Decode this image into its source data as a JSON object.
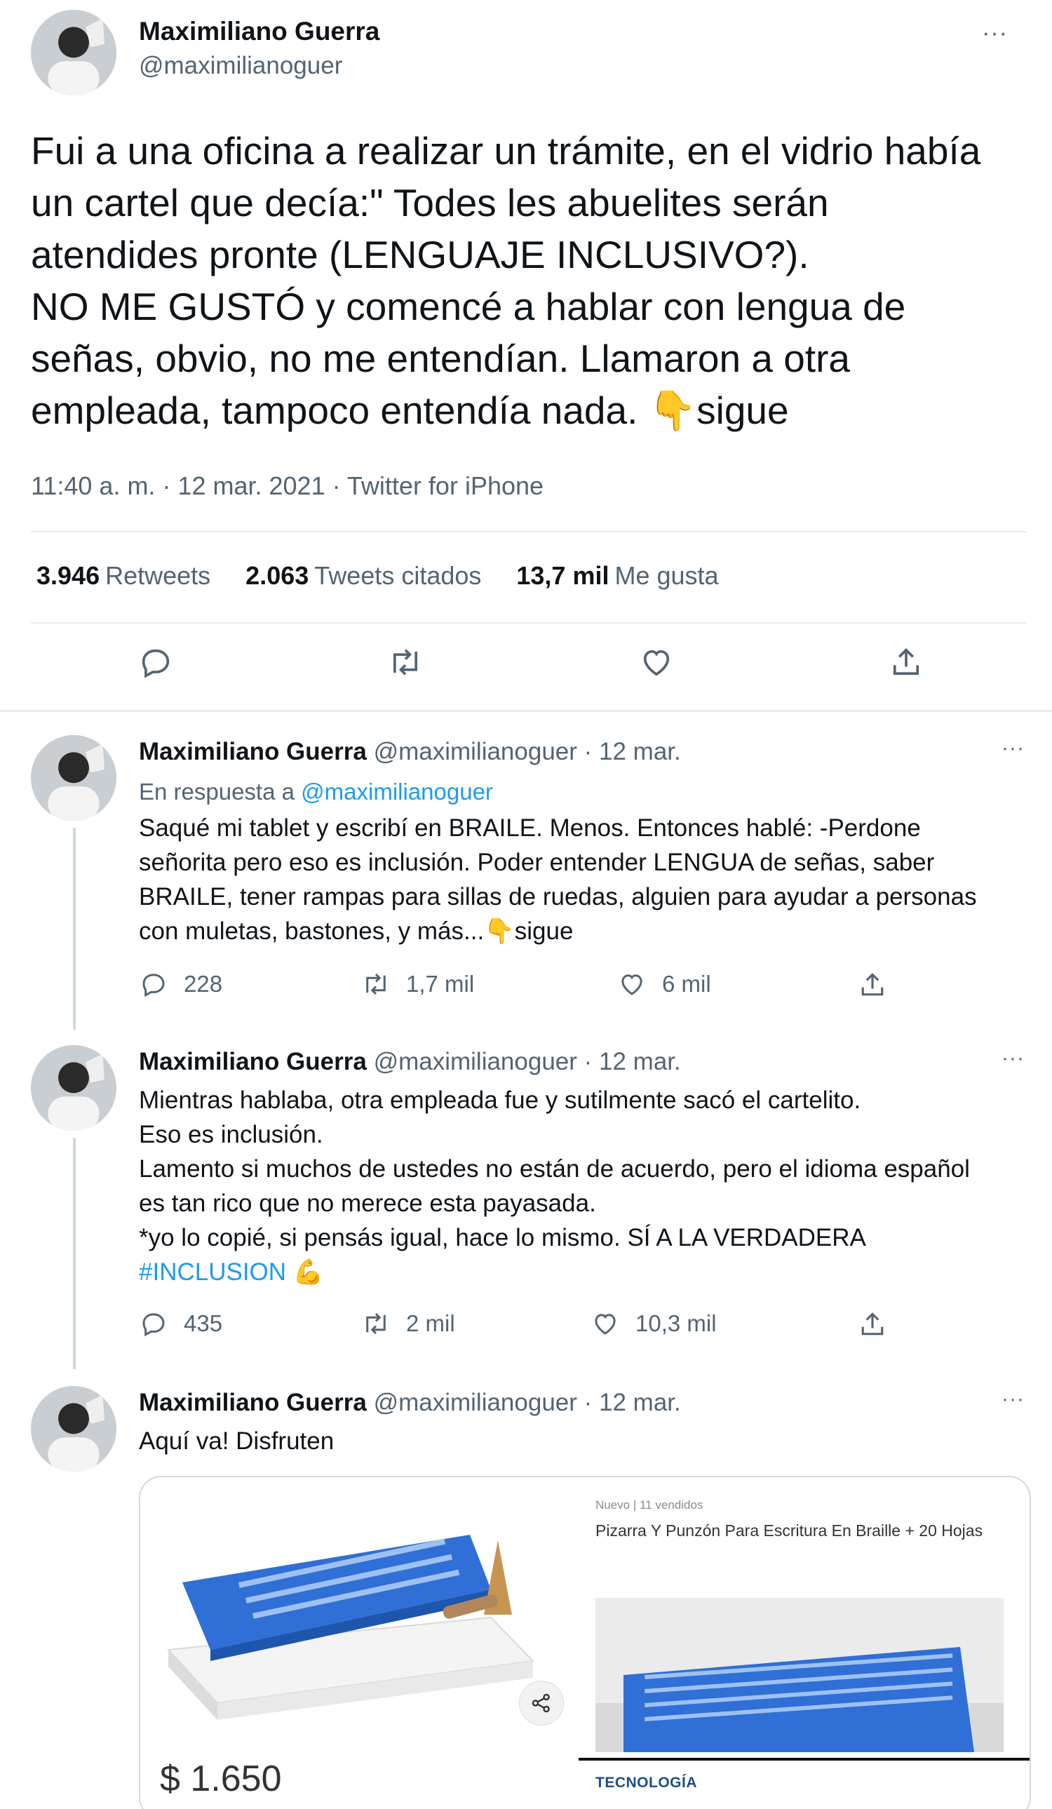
{
  "main_tweet": {
    "name": "Maximiliano Guerra",
    "handle": "@maximilianoguer",
    "more": "···",
    "text": "Fui a una oficina a realizar un trámite, en el vidrio había\nun cartel que decía:\" Todes les abuelites serán\natendides pronte (LENGUAJE INCLUSIVO?).\nNO ME GUSTÓ y comencé a hablar con lengua de\nseñas, obvio, no me entendían. Llamaron a otra\nempleada, tampoco entendía nada. 👇sigue",
    "meta": "11:40 a. m. · 12 mar. 2021 · Twitter for iPhone",
    "retweets_count": "3.946",
    "retweets_label": "Retweets",
    "quotes_count": "2.063",
    "quotes_label": "Tweets citados",
    "likes_count": "13,7 mil",
    "likes_label": "Me gusta"
  },
  "replies": [
    {
      "name": "Maximiliano Guerra",
      "handle_time": "@maximilianoguer · 12 mar.",
      "more": "···",
      "replying_prefix": "En respuesta a",
      "replying_to": "@maximilianoguer",
      "text": "Saqué mi tablet y escribí en BRAILE. Menos. Entonces hablé: -Perdone\nseñorita pero eso es inclusión. Poder entender LENGUA de señas, saber\nBRAILE, tener rampas para sillas de ruedas, alguien para ayudar a personas\ncon muletas, bastones, y más...👇sigue",
      "replies": "228",
      "retweets": "1,7 mil",
      "likes": "6 mil"
    },
    {
      "name": "Maximiliano Guerra",
      "handle_time": "@maximilianoguer · 12 mar.",
      "more": "···",
      "text": "Mientras hablaba, otra empleada fue y sutilmente sacó el cartelito.\nEso es inclusión.\nLamento si muchos de ustedes no están de acuerdo, pero el idioma español\nes tan rico que no merece esta payasada.\n*yo lo copié, si pensás igual, hace lo mismo. SÍ A LA VERDADERA",
      "hashtag": "#INCLUSION",
      "emoji": "💪",
      "replies": "435",
      "retweets": "2 mil",
      "likes": "10,3 mil"
    },
    {
      "name": "Maximiliano Guerra",
      "handle_time": "@maximilianoguer · 12 mar.",
      "more": "···",
      "text": "Aquí va! Disfruten"
    }
  ],
  "card": {
    "crumb": "Nuevo  |  11 vendidos",
    "title": "Pizarra Y Punzón Para Escritura En Braille + 20 Hojas",
    "tag": "TECNOLOGÍA",
    "price": "$ 1.650"
  },
  "colors": {
    "text": "#0f1419",
    "secondary": "#536471",
    "link": "#1d9bf0",
    "divider": "#e6ecf0",
    "slate_blue": "#2f6fd6"
  },
  "icons": [
    "reply-icon",
    "retweet-icon",
    "like-icon",
    "share-icon"
  ]
}
